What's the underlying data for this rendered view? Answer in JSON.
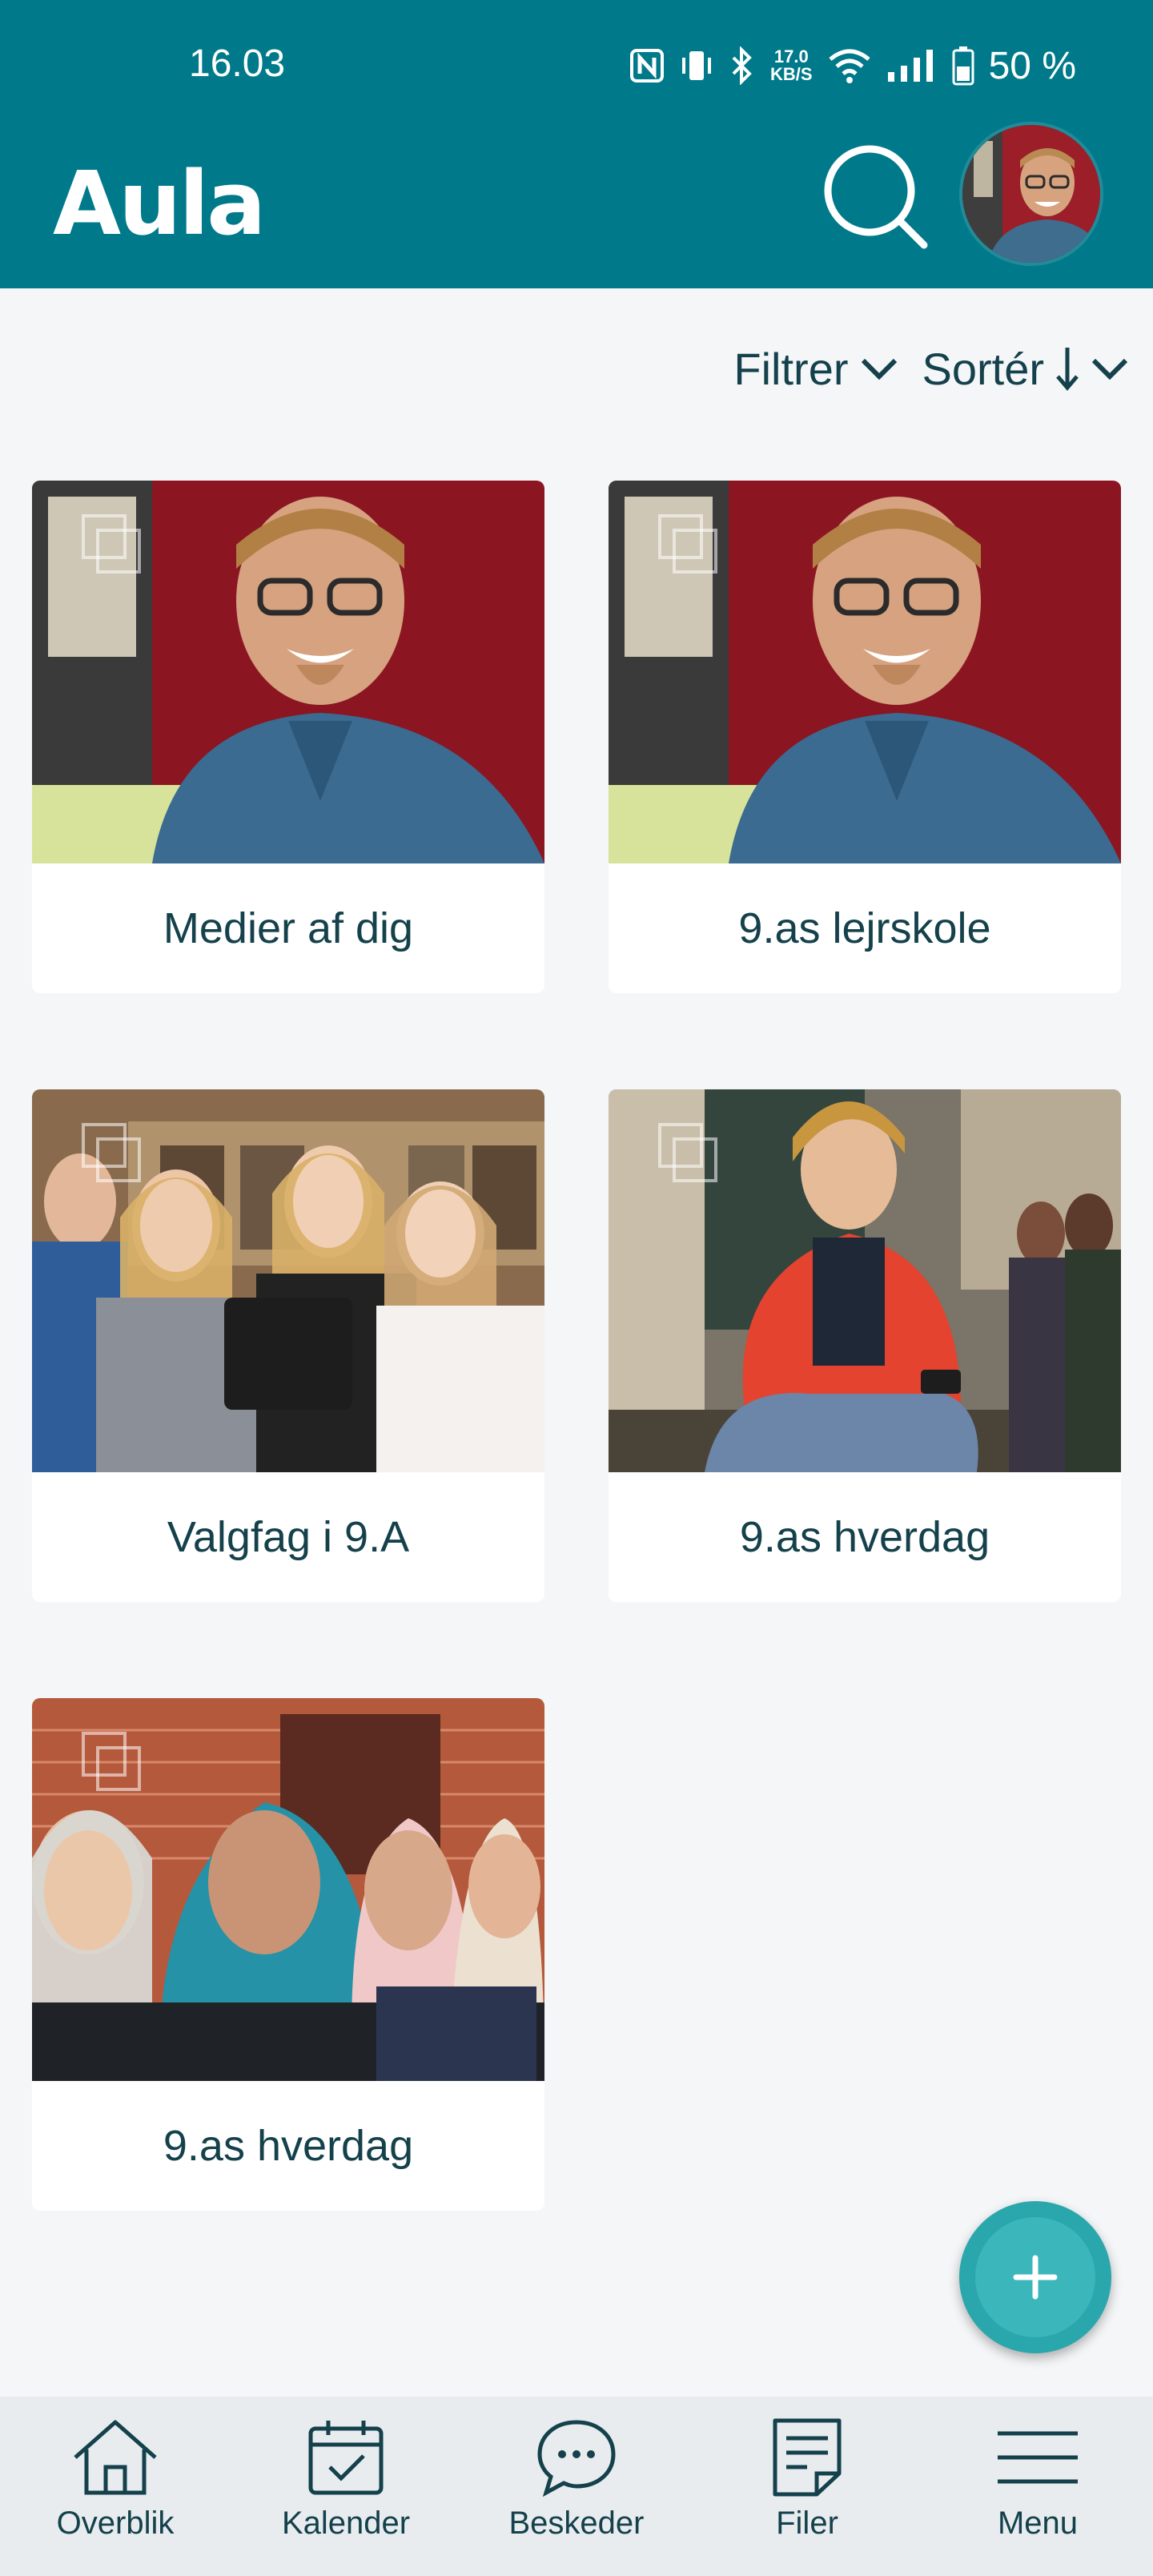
{
  "status_bar": {
    "time": "16.03",
    "net_speed_value": "17.0",
    "net_speed_unit": "KB/S",
    "battery": "50 %"
  },
  "header": {
    "title": "Aula"
  },
  "controls": {
    "filter_label": "Filtrer",
    "sort_label": "Sortér"
  },
  "albums": [
    {
      "label": "Medier af dig"
    },
    {
      "label": "9.as lejrskole"
    },
    {
      "label": "Valgfag i 9.A"
    },
    {
      "label": "9.as hverdag"
    },
    {
      "label": "9.as hverdag"
    }
  ],
  "bottom_nav": [
    {
      "label": "Overblik",
      "icon": "home-icon"
    },
    {
      "label": "Kalender",
      "icon": "calendar-icon"
    },
    {
      "label": "Beskeder",
      "icon": "chat-icon"
    },
    {
      "label": "Filer",
      "icon": "file-icon"
    },
    {
      "label": "Menu",
      "icon": "menu-icon"
    }
  ],
  "colors": {
    "brand": "#007a8a",
    "fab": "#2aa7ad",
    "text": "#14414b"
  }
}
